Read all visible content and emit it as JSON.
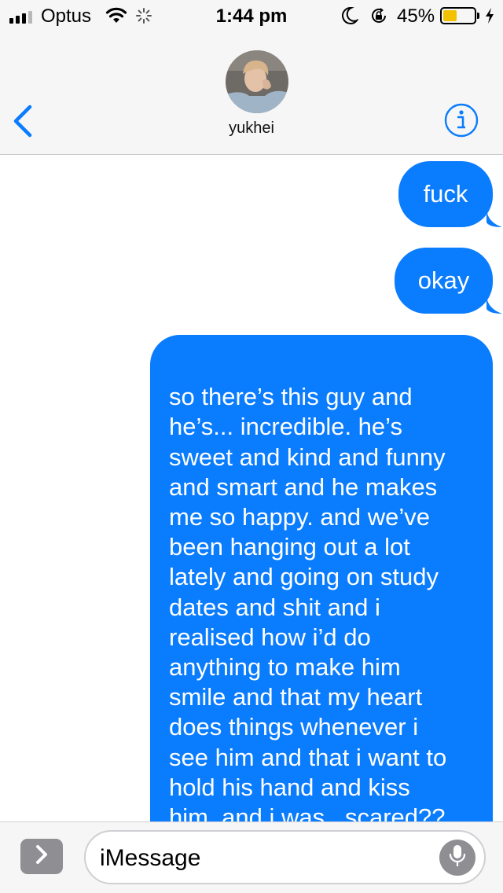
{
  "status_bar": {
    "carrier": "Optus",
    "time": "1:44 pm",
    "battery_percent": "45%",
    "battery_level": 0.45,
    "battery_color": "#f2c200",
    "signal_bars_filled": 3,
    "icons": [
      "signal-icon",
      "wifi-icon",
      "activity-spinner-icon",
      "do-not-disturb-moon-icon",
      "rotation-lock-icon",
      "battery-icon",
      "charging-bolt-icon"
    ]
  },
  "header": {
    "contact_name": "yukhei",
    "back_icon": "chevron-left-icon",
    "info_icon": "info-icon",
    "accent_color": "#0a7cfe"
  },
  "messages": [
    {
      "direction": "outgoing",
      "text": "fuck"
    },
    {
      "direction": "outgoing",
      "text": "okay"
    },
    {
      "direction": "outgoing",
      "text": "so there’s this guy and\nhe’s... incredible. he’s\nsweet and kind and funny\nand smart and he makes\nme so happy. and we’ve\nbeen hanging out a lot\nlately and going on study\ndates and shit and i\nrealised how i’d do\nanything to make him\nsmile and that my heart\ndoes things whenever i\nsee him and that i want to\nhold his hand and kiss\nhim. and i was,, scared??\nlike i hated how i was"
    }
  ],
  "bubble_color": "#0a7cfe",
  "composer": {
    "placeholder": "iMessage",
    "apps_icon": "chevron-right-icon",
    "mic_icon": "microphone-icon"
  }
}
